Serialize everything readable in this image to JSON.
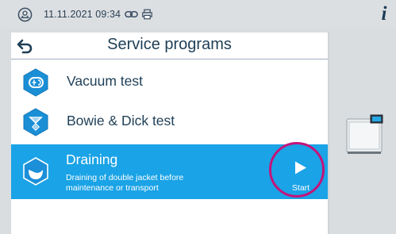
{
  "status_bar": {
    "datetime": "11.11.2021 09:34",
    "status_icon": "sterilizer-status-icon",
    "connection_icon": "network-link-icon",
    "printer_icon": "printer-icon",
    "info_icon_glyph": "i"
  },
  "header": {
    "back_icon": "back-arrow-icon",
    "title": "Service programs"
  },
  "programs": [
    {
      "label": "Vacuum test",
      "icon": "vacuum-test-icon"
    },
    {
      "label": "Bowie & Dick test",
      "icon": "bowie-dick-test-icon"
    },
    {
      "label": "Draining",
      "description": "Draining of double jacket before maintenance or transport",
      "icon": "draining-icon",
      "selected": true,
      "start_label": "Start"
    }
  ],
  "colors": {
    "accent": "#1aa3e6",
    "icon_hex": "#1a8fd6",
    "highlight_ring": "#c4147a",
    "text_dark": "#1f3f57",
    "background": "#d9dde0"
  }
}
